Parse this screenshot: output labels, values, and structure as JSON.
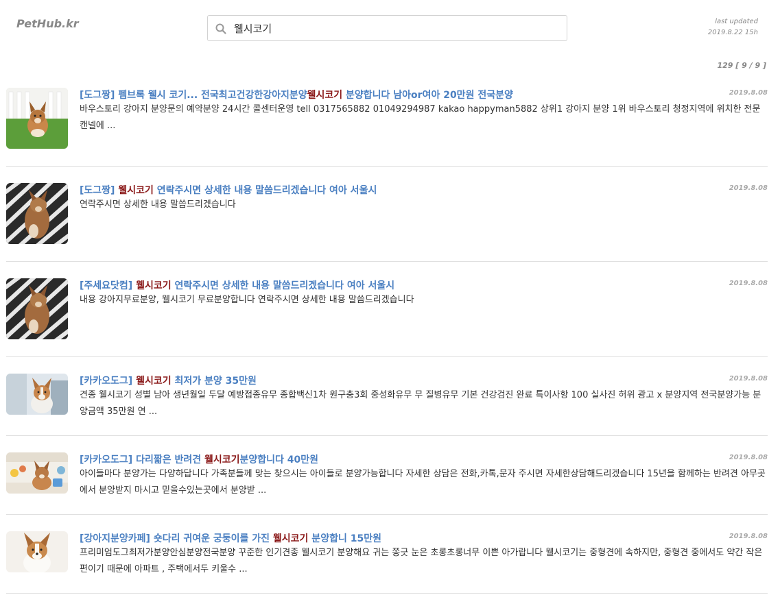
{
  "header": {
    "logo": "PetHub.kr",
    "search_value": "웰시코기",
    "updated_label": "last updated",
    "updated_time": "2019.8.22 15h",
    "result_count": "129 [ 9 / 9 ]"
  },
  "results": [
    {
      "source": "[도그짱]",
      "title_before": "펨브록 웰시 코기... 전국최고건강한강아지분양",
      "highlight": "웰시코기",
      "title_after": " 분양합니다 남아or여아 20만원 전국분양",
      "date": "2019.8.08",
      "desc": "바우스토리 강아지 분양문의 예약분양 24시간 콜센터운영 tell 0317565882 01049294987 kakao happyman5882 상위1 강아지 분양 1위 바우스토리 청정지역에 위치한 전문캔넬에 ..."
    },
    {
      "source": "[도그짱]",
      "title_before": "",
      "highlight": "웰시코기",
      "title_after": " 연락주시면 상세한 내용 말씀드리겠습니다 여아 서울시",
      "date": "2019.8.08",
      "desc": "연락주시면 상세한 내용 말씀드리겠습니다"
    },
    {
      "source": "[주세요닷컴]",
      "title_before": "",
      "highlight": "웰시코기",
      "title_after": " 연락주시면 상세한 내용 말씀드리겠습니다 여아 서울시",
      "date": "2019.8.08",
      "desc": "내용 강아지무료분양, 웰시코기 무료분양합니다 연락주시면 상세한 내용 말씀드리겠습니다"
    },
    {
      "source": "[카카오도그]",
      "title_before": "",
      "highlight": "웰시코기",
      "title_after": " 최저가 분양 35만원",
      "date": "2019.8.08",
      "desc": "견종 웰시코기 성별 남아 생년월일 두달 예방접종유무 종합백신1차 원구충3회 중성화유무 무 질병유무 기본 건강검진 완료 특이사항 100 실사진 허위 광고 x 분양지역 전국분양가능 분양금액 35만원 연 ..."
    },
    {
      "source": "[카카오도그]",
      "title_before": "다리짧은 반려견 ",
      "highlight": "웰시코기",
      "title_after": "분양합니다 40만원",
      "date": "2019.8.08",
      "desc": "아이들마다 분양가는 다양하답니다 가족분들께 맞는 찾으시는 아이들로 분양가능합니다 자세한 상담은 전화,카톡,문자 주시면 자세한상담해드리겠습니다 15년을 함께하는 반려견 아무곳에서 분양받지 마시고 믿을수있는곳에서 분양받 ..."
    },
    {
      "source": "[강아지분양카페]",
      "title_before": "숏다리 귀여운 궁둥이를 가진 ",
      "highlight": "웰시코기",
      "title_after": " 분양합니 15만원",
      "date": "2019.8.08",
      "desc": "프리미엄도그최저가분양안심분양전국분양 꾸준한 인기견종 웰시코기 분양해요 귀는 쫑긋 눈은 초롱초롱너무 이쁜 아가랍니다 웰시코기는 중형견에 속하지만, 중형견 중에서도 약간 작은편이기 때문에 아파트 , 주택에서두 키울수 ..."
    }
  ]
}
